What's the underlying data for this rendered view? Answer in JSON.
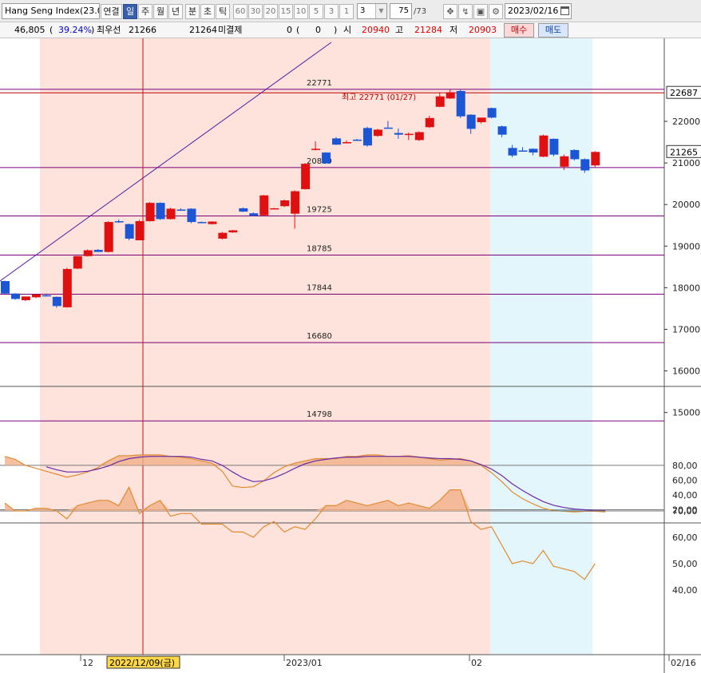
{
  "toolbar": {
    "symbol": "Hang Seng Index(23.0",
    "periods": [
      "연결",
      "일",
      "주",
      "월",
      "년",
      "분",
      "초",
      "틱"
    ],
    "selected_period": "일",
    "minute_options": [
      "60",
      "30",
      "20",
      "15",
      "10",
      "5",
      "3",
      "1"
    ],
    "interval_value": "3",
    "count_value": "75",
    "count_total": "/73",
    "date_value": "2023/02/16"
  },
  "quote": {
    "volume": "46,805",
    "open_paren": "(",
    "change_pct": "39.24%",
    "close_paren": ")",
    "best_bid_label": "최우선",
    "best_bid_value": "21266",
    "best_ask_value": "21264",
    "unsettled_label": "미결제",
    "unsettled_value": "0",
    "unsettled_paren_open": "(",
    "unsettled_change": "0",
    "unsettled_paren_close": ")",
    "open_label": "시",
    "open_value": "20940",
    "high_label": "고",
    "high_value": "21284",
    "low_label": "저",
    "low_value": "20903",
    "buy_label": "매수",
    "sell_label": "매도"
  },
  "colors": {
    "up": "#e01010",
    "down": "#1a56d6",
    "band_pink": "#fde3dc",
    "band_blue": "#e3f6fc",
    "level_line": "#7a007a",
    "stoch": "#e38a2e"
  },
  "chart_data": [
    {
      "type": "candlestick",
      "y_range": [
        14600,
        22900
      ],
      "y_ticks": [
        "22000",
        "21000",
        "20000",
        "19000",
        "18000",
        "17000",
        "16000",
        "15000"
      ],
      "candles": [
        {
          "o": 18160,
          "h": 18170,
          "l": 17860,
          "c": 17860
        },
        {
          "o": 17860,
          "h": 17870,
          "l": 17710,
          "c": 17730
        },
        {
          "o": 17700,
          "h": 17780,
          "l": 17680,
          "c": 17790
        },
        {
          "o": 17770,
          "h": 17840,
          "l": 17750,
          "c": 17840
        },
        {
          "o": 17820,
          "h": 17860,
          "l": 17790,
          "c": 17800
        },
        {
          "o": 17780,
          "h": 17790,
          "l": 17520,
          "c": 17560
        },
        {
          "o": 17530,
          "h": 18480,
          "l": 17520,
          "c": 18450
        },
        {
          "o": 18460,
          "h": 18760,
          "l": 18450,
          "c": 18760
        },
        {
          "o": 18760,
          "h": 18920,
          "l": 18750,
          "c": 18900
        },
        {
          "o": 18910,
          "h": 18930,
          "l": 18860,
          "c": 18860
        },
        {
          "o": 18860,
          "h": 19600,
          "l": 18850,
          "c": 19580
        },
        {
          "o": 19600,
          "h": 19640,
          "l": 19560,
          "c": 19590
        },
        {
          "o": 19530,
          "h": 19540,
          "l": 19140,
          "c": 19180
        },
        {
          "o": 19140,
          "h": 19630,
          "l": 19140,
          "c": 19600
        },
        {
          "o": 19600,
          "h": 20060,
          "l": 19590,
          "c": 20040
        },
        {
          "o": 20040,
          "h": 20050,
          "l": 19630,
          "c": 19650
        },
        {
          "o": 19650,
          "h": 19920,
          "l": 19640,
          "c": 19900
        },
        {
          "o": 19880,
          "h": 19910,
          "l": 19850,
          "c": 19860
        },
        {
          "o": 19900,
          "h": 19910,
          "l": 19550,
          "c": 19580
        },
        {
          "o": 19580,
          "h": 19590,
          "l": 19560,
          "c": 19575
        },
        {
          "o": 19530,
          "h": 19600,
          "l": 19520,
          "c": 19590
        },
        {
          "o": 19180,
          "h": 19340,
          "l": 19160,
          "c": 19320
        },
        {
          "o": 19330,
          "h": 19390,
          "l": 19320,
          "c": 19380
        },
        {
          "o": 19910,
          "h": 19930,
          "l": 19820,
          "c": 19830
        },
        {
          "o": 19790,
          "h": 19810,
          "l": 19720,
          "c": 19730
        },
        {
          "o": 19740,
          "h": 20230,
          "l": 19730,
          "c": 20220
        },
        {
          "o": 19910,
          "h": 19920,
          "l": 19900,
          "c": 19910
        },
        {
          "o": 19960,
          "h": 20120,
          "l": 19940,
          "c": 20100
        },
        {
          "o": 19780,
          "h": 20340,
          "l": 19420,
          "c": 20320
        },
        {
          "o": 20370,
          "h": 21000,
          "l": 20360,
          "c": 20980
        },
        {
          "o": 21320,
          "h": 21520,
          "l": 21300,
          "c": 21340
        },
        {
          "o": 21250,
          "h": 21260,
          "l": 20980,
          "c": 20990
        },
        {
          "o": 21590,
          "h": 21620,
          "l": 21430,
          "c": 21440
        },
        {
          "o": 21500,
          "h": 21540,
          "l": 21470,
          "c": 21500
        },
        {
          "o": 21560,
          "h": 21580,
          "l": 21540,
          "c": 21550
        },
        {
          "o": 21840,
          "h": 21870,
          "l": 21390,
          "c": 21420
        },
        {
          "o": 21650,
          "h": 21820,
          "l": 21630,
          "c": 21800
        },
        {
          "o": 21850,
          "h": 22010,
          "l": 21830,
          "c": 21840
        },
        {
          "o": 21720,
          "h": 21830,
          "l": 21580,
          "c": 21680
        },
        {
          "o": 21680,
          "h": 21730,
          "l": 21550,
          "c": 21700
        },
        {
          "o": 21550,
          "h": 21760,
          "l": 21530,
          "c": 21740
        },
        {
          "o": 21860,
          "h": 22130,
          "l": 21840,
          "c": 22080
        },
        {
          "o": 22350,
          "h": 22700,
          "l": 22340,
          "c": 22600
        },
        {
          "o": 22550,
          "h": 22771,
          "l": 22540,
          "c": 22700
        },
        {
          "o": 22730,
          "h": 22760,
          "l": 22080,
          "c": 22120
        },
        {
          "o": 22160,
          "h": 22170,
          "l": 21700,
          "c": 21820
        },
        {
          "o": 21980,
          "h": 22020,
          "l": 21950,
          "c": 22090
        },
        {
          "o": 22320,
          "h": 22330,
          "l": 22070,
          "c": 22090
        },
        {
          "o": 21880,
          "h": 21900,
          "l": 21620,
          "c": 21680
        },
        {
          "o": 21360,
          "h": 21430,
          "l": 21140,
          "c": 21180
        },
        {
          "o": 21300,
          "h": 21380,
          "l": 21280,
          "c": 21290
        },
        {
          "o": 21340,
          "h": 21350,
          "l": 21180,
          "c": 21250
        },
        {
          "o": 21150,
          "h": 21680,
          "l": 21140,
          "c": 21660
        },
        {
          "o": 21580,
          "h": 21590,
          "l": 21160,
          "c": 21200
        },
        {
          "o": 20910,
          "h": 21200,
          "l": 20830,
          "c": 21160
        },
        {
          "o": 21310,
          "h": 21330,
          "l": 21060,
          "c": 21090
        },
        {
          "o": 21090,
          "h": 21110,
          "l": 20760,
          "c": 20820
        },
        {
          "o": 20940,
          "h": 21284,
          "l": 20903,
          "c": 21265
        }
      ],
      "levels": [
        {
          "value": 22771,
          "label": "22771"
        },
        {
          "value": 20889,
          "label": "20889"
        },
        {
          "value": 19725,
          "label": "19725"
        },
        {
          "value": 18785,
          "label": "18785"
        },
        {
          "value": 17844,
          "label": "17844"
        },
        {
          "value": 16680,
          "label": "16680"
        },
        {
          "value": 14798,
          "label": "14798"
        }
      ],
      "high_annotation": "최고 22771 (01/27)",
      "price_tags": [
        "22687",
        "21265"
      ],
      "price_tag_values": [
        22687,
        21265
      ],
      "cursor_date": "2022/12/09(금)",
      "x_labels": [
        "12",
        "2023/01",
        "02",
        "02/16"
      ]
    },
    {
      "type": "line",
      "y_range": [
        5,
        105
      ],
      "y_ticks": [
        "80,00",
        "60,00",
        "40,00",
        "20,00"
      ],
      "reference_lines": [
        80,
        20
      ],
      "series": [
        {
          "values": [
            92,
            88,
            80,
            76,
            72,
            68,
            64,
            67,
            71,
            77,
            86,
            93,
            93,
            94,
            94,
            94,
            92,
            91,
            89,
            86,
            83,
            72,
            52,
            50,
            51,
            59,
            70,
            78,
            83,
            86,
            89,
            89,
            89,
            92,
            92,
            94,
            94,
            92,
            92,
            93,
            91,
            89,
            87,
            88,
            89,
            86,
            80,
            70,
            58,
            44,
            35,
            28,
            22,
            19,
            18,
            17,
            18,
            18,
            17
          ]
        },
        {
          "values": [
            null,
            null,
            null,
            null,
            78,
            74,
            71,
            71,
            72,
            75,
            79,
            85,
            89,
            91,
            92,
            92,
            92,
            92,
            91,
            88,
            86,
            80,
            71,
            63,
            58,
            59,
            63,
            69,
            76,
            82,
            86,
            88,
            90,
            91,
            91,
            92,
            92,
            92,
            92,
            92,
            91,
            90,
            89,
            89,
            88,
            86,
            81,
            75,
            66,
            55,
            46,
            38,
            31,
            26,
            23,
            21,
            20,
            19,
            19
          ]
        }
      ]
    },
    {
      "type": "line",
      "y_range": [
        33,
        78
      ],
      "y_ticks": [
        "70,00",
        "60,00",
        "50,00",
        "40,00"
      ],
      "reference_lines": [
        70
      ],
      "series": [
        {
          "values": [
            73,
            70,
            70,
            71,
            71,
            70,
            67,
            72,
            73,
            74,
            74,
            72,
            79,
            69,
            72,
            74,
            68,
            69,
            69,
            65,
            65,
            65,
            62,
            62,
            60,
            64,
            66,
            62,
            64,
            63,
            67,
            72,
            72,
            74,
            73,
            72,
            73,
            74,
            72,
            73,
            72,
            71,
            74,
            78,
            78,
            66,
            63,
            64,
            57,
            50,
            51,
            50,
            55,
            49,
            48,
            47,
            44,
            50
          ]
        }
      ]
    }
  ]
}
